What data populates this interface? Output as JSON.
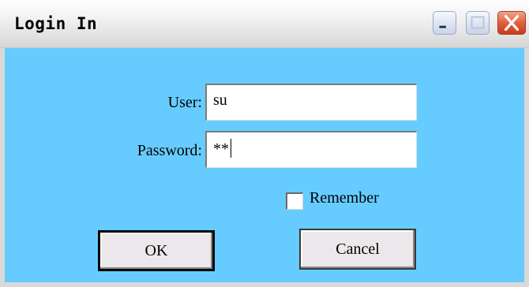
{
  "window": {
    "title": "Login In",
    "controls": {
      "minimize_icon": "minimize-icon",
      "maximize_icon": "maximize-icon",
      "close_icon": "close-icon"
    }
  },
  "form": {
    "user_label": "User:",
    "user_value": "su",
    "password_label": "Password:",
    "password_value": "**",
    "remember_label": "Remember",
    "remember_checked": false
  },
  "buttons": {
    "ok_label": "OK",
    "cancel_label": "Cancel"
  },
  "colors": {
    "background": "#66ccff",
    "titlebar": "#e2e2e2",
    "close_button": "#e0603c",
    "button_face": "#ece7ea"
  }
}
